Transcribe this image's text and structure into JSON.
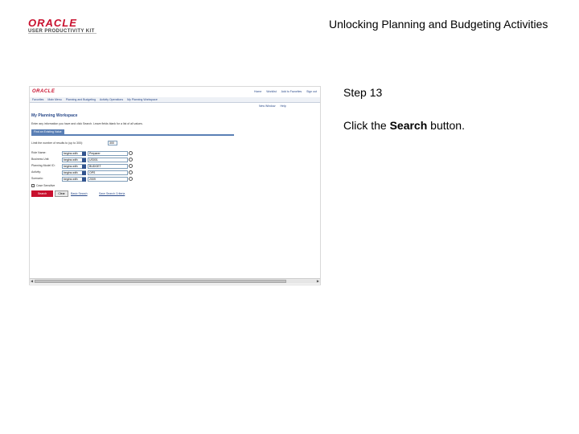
{
  "header": {
    "logo_text": "ORACLE",
    "logo_subtitle": "USER PRODUCTIVITY KIT",
    "slide_title": "Unlocking Planning and Budgeting Activities"
  },
  "screenshot": {
    "app_logo": "ORACLE",
    "top_links": [
      "Home",
      "Worklist",
      "Add to Favorites",
      "Sign out"
    ],
    "breadcrumbs": [
      "Favorites",
      "Main Menu",
      "Planning and Budgeting",
      "Activity Operations",
      "My Planning Workspace"
    ],
    "toolbar_links": [
      "New Window",
      "Help"
    ],
    "page_title": "My Planning Workspace",
    "instructions": "Enter any information you have and click Search. Leave fields blank for a list of all values.",
    "section_tab": "Find an Existing Value",
    "limit_label": "Limit the number of results to (up to 300):",
    "limit_value": "300",
    "criteria": [
      {
        "label": "Role Name:",
        "operator": "begins with",
        "value": "Preparer"
      },
      {
        "label": "Business Unit:",
        "operator": "begins with",
        "value": "US001"
      },
      {
        "label": "Planning Model ID:",
        "operator": "begins with",
        "value": "BUDGET"
      },
      {
        "label": "Activity:",
        "operator": "begins with",
        "value": "OPS"
      },
      {
        "label": "Scenario:",
        "operator": "begins with",
        "value": "2009"
      }
    ],
    "case_sensitive_label": "Case Sensitive",
    "search_button": "Search",
    "clear_button": "Clear",
    "basic_search_link": "Basic Search",
    "save_search_link": "Save Search Criteria"
  },
  "instruction_panel": {
    "step_label": "Step 13",
    "text_before": "Click the ",
    "text_bold": "Search",
    "text_after": " button."
  }
}
